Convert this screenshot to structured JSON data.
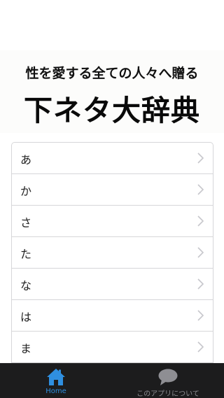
{
  "banner": {
    "subtitle": "性を愛する全ての人々へ贈る",
    "title": "下ネタ大辞典"
  },
  "list": {
    "items": [
      {
        "label": "あ"
      },
      {
        "label": "か"
      },
      {
        "label": "さ"
      },
      {
        "label": "た"
      },
      {
        "label": "な"
      },
      {
        "label": "は"
      },
      {
        "label": "ま"
      }
    ]
  },
  "tabbar": {
    "tabs": [
      {
        "label": "Home",
        "icon": "house-icon",
        "active": true
      },
      {
        "label": "このアプリについて",
        "icon": "speech-bubble-icon",
        "active": false
      }
    ]
  },
  "colors": {
    "active_tab": "#2f8fe0",
    "inactive_tab": "#8e8e93",
    "tab_bar_bg": "#1c1c1d",
    "chevron": "#c7c7cc"
  }
}
